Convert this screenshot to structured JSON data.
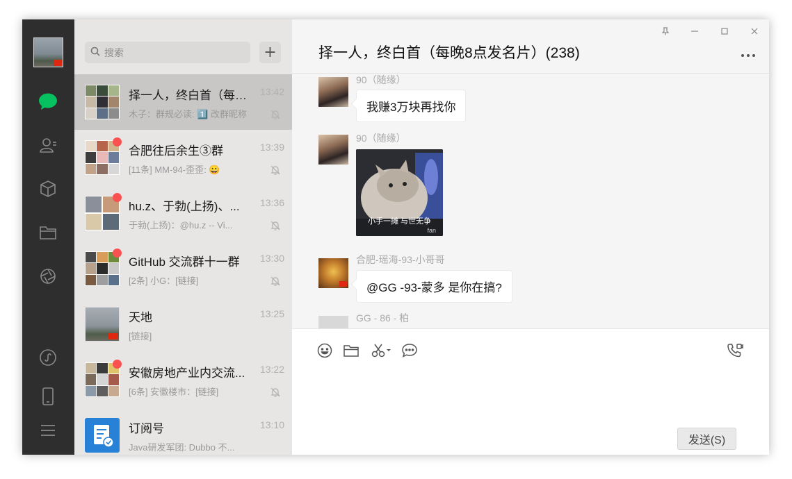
{
  "search": {
    "placeholder": "搜索"
  },
  "add_button": "+",
  "chats": [
    {
      "name": "择一人，终白首（每晚8点发名片）",
      "time": "13:42",
      "preview": "木子：群规必读: 1️⃣ 改群昵称",
      "muted": true,
      "unread_dot": false,
      "active": true
    },
    {
      "name": "合肥往后余生③群",
      "time": "13:39",
      "preview": "[11条] MM-94-歪歪: 😀",
      "muted": true,
      "unread_dot": true,
      "active": false
    },
    {
      "name": "hu.z、于勃(上扬)、...",
      "time": "13:36",
      "preview": "于勃(上扬)：@hu.z -- Vi...",
      "muted": true,
      "unread_dot": true,
      "active": false
    },
    {
      "name": "GitHub 交流群十一群",
      "time": "13:30",
      "preview": "[2条] 小G：[链接]",
      "muted": true,
      "unread_dot": true,
      "active": false
    },
    {
      "name": "天地",
      "time": "13:25",
      "preview": "[链接]",
      "muted": false,
      "unread_dot": false,
      "active": false
    },
    {
      "name": "安徽房地产业内交流...",
      "time": "13:22",
      "preview": "[6条] 安徽楼市：[链接]",
      "muted": true,
      "unread_dot": true,
      "active": false
    },
    {
      "name": "订阅号",
      "time": "13:10",
      "preview": "Java研发军团: Dubbo 不...",
      "muted": false,
      "unread_dot": false,
      "active": false
    }
  ],
  "conversation": {
    "title": "择一人，终白首（每晚8点发名片）(238)",
    "messages": [
      {
        "sender": "90（随缘）",
        "text": "我赚3万块再找你"
      },
      {
        "sender": "90（随缘）",
        "image_caption": "小手一摊 与世无争",
        "image_watermark": "fan"
      },
      {
        "sender": "合肥-瑶海-93-小哥哥",
        "text": "@GG -93-蒙多 是你在搞?"
      },
      {
        "sender": "GG - 86 - 柏"
      }
    ]
  },
  "composer": {
    "send_label": "发送(S)"
  },
  "colors": {
    "accent": "#07c160",
    "unread": "#fa5151",
    "rail": "#2e2e2e"
  }
}
